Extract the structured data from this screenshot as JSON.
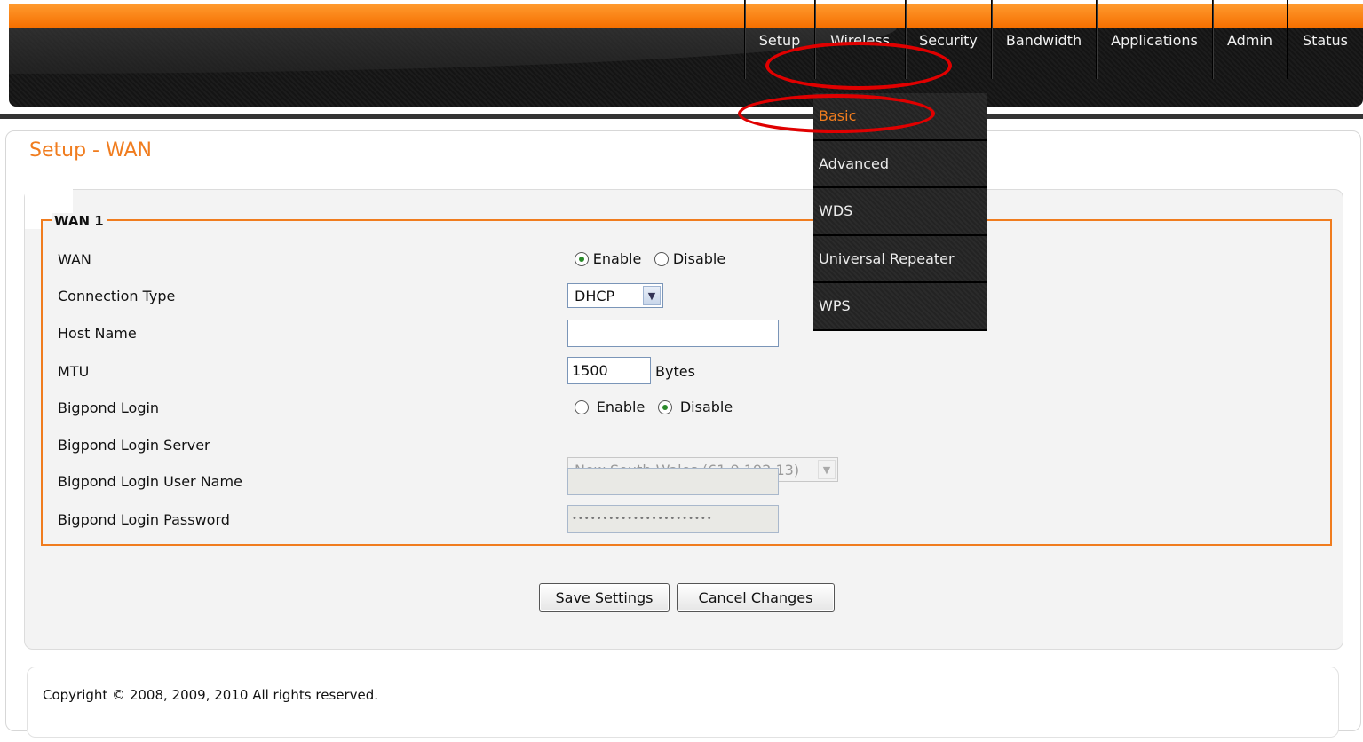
{
  "header": {
    "nav": [
      {
        "label": "Setup"
      },
      {
        "label": "Wireless"
      },
      {
        "label": "Security"
      },
      {
        "label": "Bandwidth"
      },
      {
        "label": "Applications"
      },
      {
        "label": "Admin"
      },
      {
        "label": "Status"
      }
    ]
  },
  "dropdown": {
    "items": [
      {
        "label": "Basic",
        "active": true
      },
      {
        "label": "Advanced"
      },
      {
        "label": "WDS"
      },
      {
        "label": "Universal Repeater"
      },
      {
        "label": "WPS"
      }
    ]
  },
  "page": {
    "title": "Setup - WAN",
    "section_legend": "WAN 1"
  },
  "form": {
    "wan": {
      "label": "WAN",
      "enable_label": "Enable",
      "disable_label": "Disable",
      "selected": "Enable"
    },
    "connection_type": {
      "label": "Connection Type",
      "value": "DHCP"
    },
    "host_name": {
      "label": "Host Name",
      "value": ""
    },
    "mtu": {
      "label": "MTU",
      "value": "1500",
      "unit": "Bytes"
    },
    "bigpond_login": {
      "label": "Bigpond Login",
      "enable_label": "Enable",
      "disable_label": "Disable",
      "selected": "Disable"
    },
    "bigpond_server": {
      "label": "Bigpond Login Server",
      "value": "New South Wales (61.9.192.13)"
    },
    "bigpond_user": {
      "label": "Bigpond Login User Name",
      "value": ""
    },
    "bigpond_password": {
      "label": "Bigpond Login Password",
      "value": "•••••••••••••••••••••••"
    }
  },
  "buttons": {
    "save": "Save Settings",
    "cancel": "Cancel Changes"
  },
  "footer": {
    "copyright": "Copyright © 2008, 2009, 2010 All rights reserved."
  },
  "colors": {
    "accent": "#f07c1e",
    "annotation": "#e00000"
  },
  "icons": {
    "select_arrow": "chevron-down-icon"
  }
}
